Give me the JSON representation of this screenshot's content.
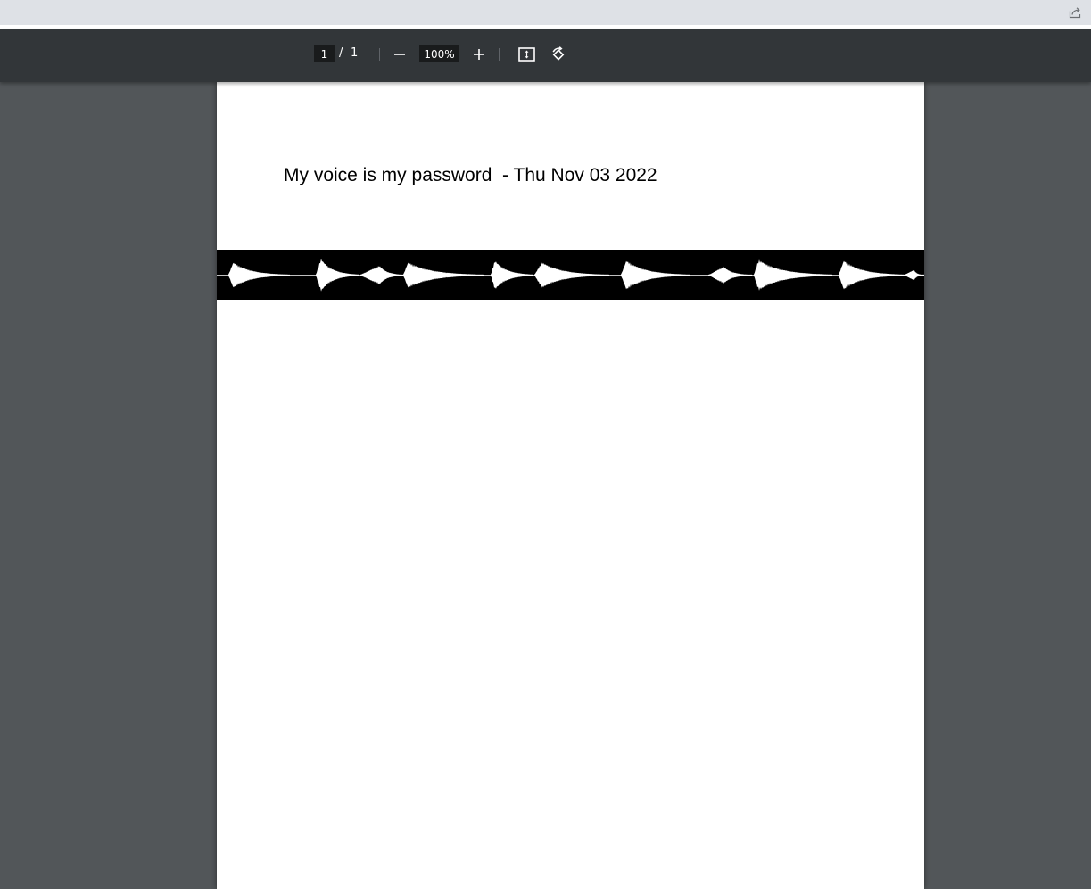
{
  "browser": {
    "share_icon": "share-icon"
  },
  "toolbar": {
    "page_current": "1",
    "page_separator": "/",
    "page_total": "1",
    "zoom_value": "100%",
    "zoom_out_icon": "minus-icon",
    "zoom_in_icon": "plus-icon",
    "fit_icon": "fit-to-page-icon",
    "rotate_icon": "rotate-icon"
  },
  "document": {
    "title": "My voice is my password  - Thu Nov 03 2022",
    "waveform_image": "audio-waveform",
    "waveform_color": "#ffffff",
    "waveform_background": "#000000"
  }
}
